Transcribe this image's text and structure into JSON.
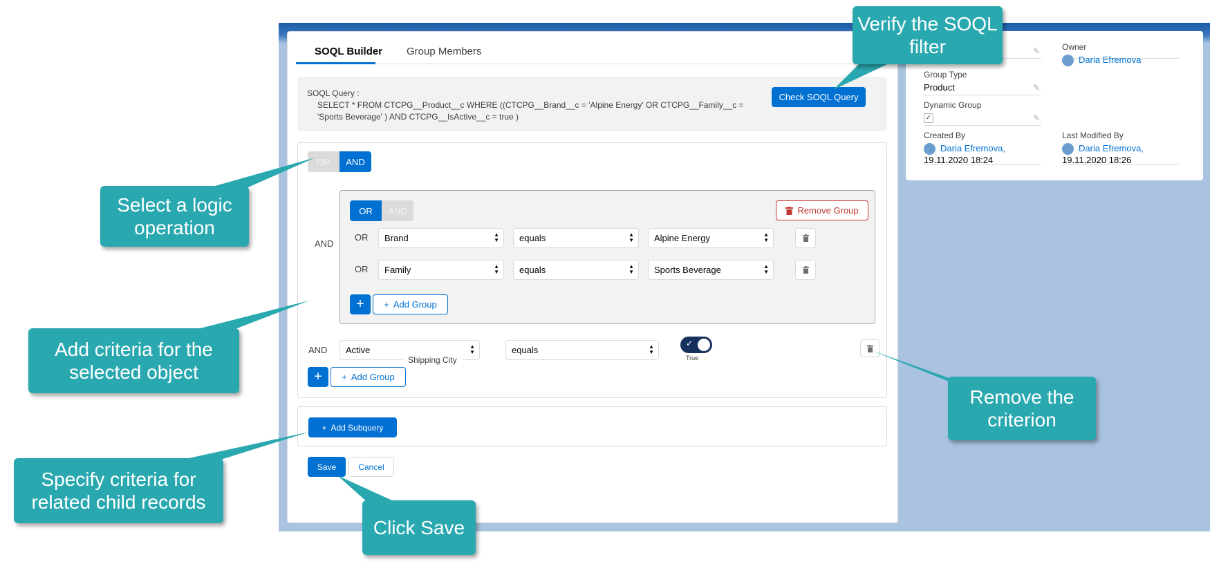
{
  "tabs": [
    {
      "label": "SOQL Builder",
      "active": true
    },
    {
      "label": "Group Members",
      "active": false
    }
  ],
  "query": {
    "label": "SOQL Query :",
    "text": "SELECT * FROM CTCPG__Product__c WHERE ((CTCPG__Brand__c = 'Alpine Energy' OR CTCPG__Family__c = 'Sports Beverage' ) AND CTCPG__IsActive__c = true )",
    "check_button": "Check SOQL Query"
  },
  "builder": {
    "top_toggle": {
      "left": "OR",
      "right": "AND",
      "selected": "AND"
    },
    "group_operator": "AND",
    "group": {
      "toggle": {
        "left": "OR",
        "right": "AND",
        "selected": "OR"
      },
      "remove_label": "Remove Group",
      "rows": [
        {
          "op": "OR",
          "field": "Brand",
          "operator": "equals",
          "value": "Alpine Energy"
        },
        {
          "op": "OR",
          "field": "Family",
          "operator": "equals",
          "value": "Sports Beverage"
        }
      ],
      "add_group_label": "Add Group"
    },
    "criterion": {
      "op": "AND",
      "field": "Active",
      "dropdown_hint": "Shipping City",
      "operator": "equals",
      "toggle_label": "True"
    },
    "add_group_label": "Add Group",
    "plus_symbol": "+"
  },
  "subquery": {
    "button": "Add Subquery"
  },
  "actions": {
    "save": "Save",
    "cancel": "Cancel"
  },
  "details": {
    "owner_label": "Owner",
    "owner_value": "Daria Efremova",
    "group_type_label": "Group Type",
    "group_type_value": "Product",
    "dynamic_label": "Dynamic Group",
    "dynamic_checked": true,
    "created_by_label": "Created By",
    "created_by_name": "Daria Efremova,",
    "created_by_date": "19.11.2020 18:24",
    "modified_by_label": "Last Modified By",
    "modified_by_name": "Daria Efremova,",
    "modified_by_date": "19.11.2020 18:26"
  },
  "callouts": {
    "verify": "Verify the SOQL filter",
    "logic": "Select a logic operation",
    "criteria": "Add criteria for the selected object",
    "remove": "Remove the criterion",
    "child": "Specify criteria for related child records",
    "save": "Click Save"
  },
  "colors": {
    "brand": "#0070d2",
    "callout": "#2aa8b0",
    "danger": "#c23934",
    "background": "#a9c3e0"
  }
}
